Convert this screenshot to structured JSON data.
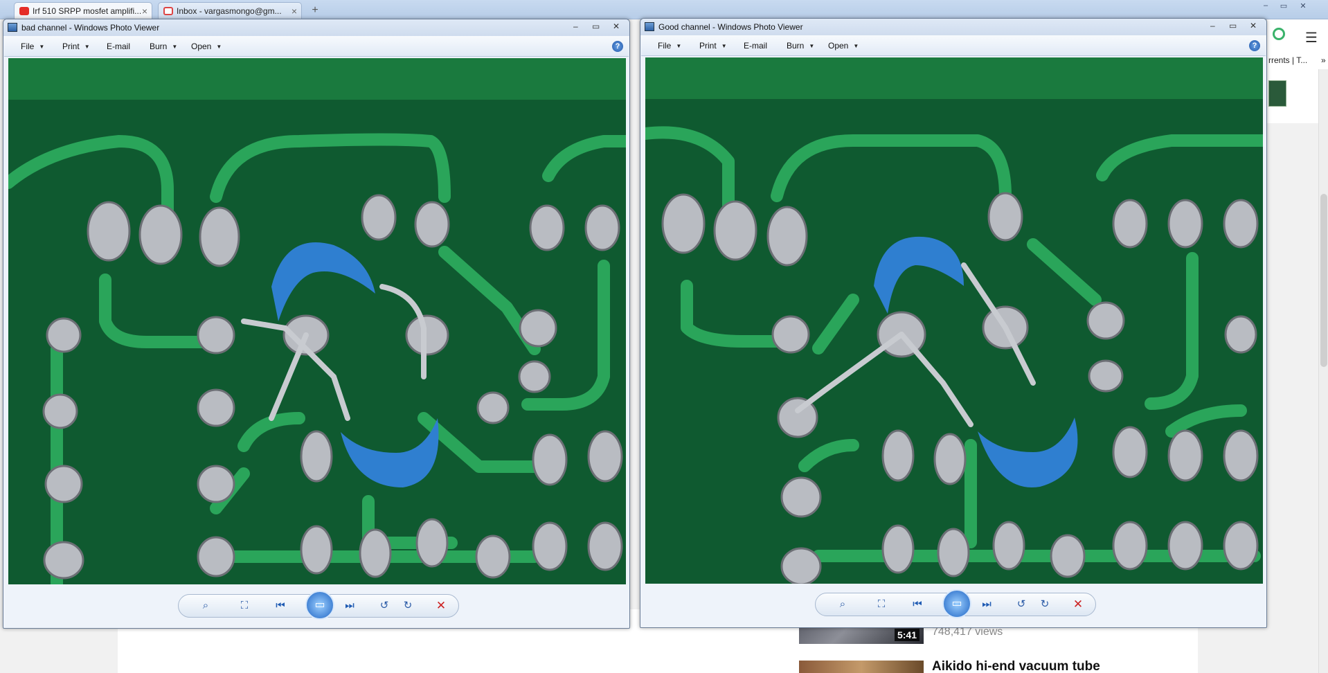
{
  "browser": {
    "tabs": [
      {
        "label": "Irf 510 SRPP mosfet amplifi...",
        "close": "×",
        "active": true
      },
      {
        "label": "Inbox - vargasmongo@gm...",
        "close": "×",
        "active": false
      }
    ],
    "new_tab": "+",
    "window_controls": [
      "–",
      "▭",
      "✕"
    ]
  },
  "background_page": {
    "tab_text": "rrents | T...",
    "more": "»",
    "video": {
      "duration": "5:41",
      "views": "748,417 views",
      "next_title": "Aikido hi-end vacuum tube"
    }
  },
  "windows": [
    {
      "title": "bad channel - Windows Photo Viewer",
      "menu": [
        "File",
        "Print",
        "E-mail",
        "Burn",
        "Open"
      ],
      "help": "?",
      "controls": [
        "–",
        "▭",
        "✕"
      ]
    },
    {
      "title": "Good channel - Windows Photo Viewer",
      "menu": [
        "File",
        "Print",
        "E-mail",
        "Burn",
        "Open"
      ],
      "help": "?",
      "controls": [
        "–",
        "▭",
        "✕"
      ]
    }
  ],
  "toolbar_icons": [
    "zoom-icon",
    "fit-window-icon",
    "previous-icon",
    "slideshow-icon",
    "next-icon",
    "rotate-left-icon",
    "rotate-right-icon",
    "delete-icon"
  ],
  "colors": {
    "pcb": "#0f5a30",
    "trace": "#2aa55a",
    "capacitor": "#2f7fd0",
    "solder": "#b9bcc2"
  }
}
